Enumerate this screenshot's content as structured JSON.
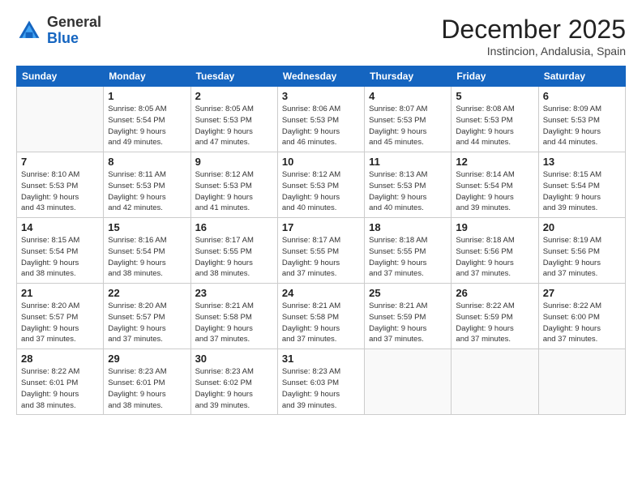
{
  "logo": {
    "general": "General",
    "blue": "Blue"
  },
  "header": {
    "month": "December 2025",
    "location": "Instincion, Andalusia, Spain"
  },
  "weekdays": [
    "Sunday",
    "Monday",
    "Tuesday",
    "Wednesday",
    "Thursday",
    "Friday",
    "Saturday"
  ],
  "weeks": [
    [
      {
        "day": "",
        "info": ""
      },
      {
        "day": "1",
        "info": "Sunrise: 8:05 AM\nSunset: 5:54 PM\nDaylight: 9 hours\nand 49 minutes."
      },
      {
        "day": "2",
        "info": "Sunrise: 8:05 AM\nSunset: 5:53 PM\nDaylight: 9 hours\nand 47 minutes."
      },
      {
        "day": "3",
        "info": "Sunrise: 8:06 AM\nSunset: 5:53 PM\nDaylight: 9 hours\nand 46 minutes."
      },
      {
        "day": "4",
        "info": "Sunrise: 8:07 AM\nSunset: 5:53 PM\nDaylight: 9 hours\nand 45 minutes."
      },
      {
        "day": "5",
        "info": "Sunrise: 8:08 AM\nSunset: 5:53 PM\nDaylight: 9 hours\nand 44 minutes."
      },
      {
        "day": "6",
        "info": "Sunrise: 8:09 AM\nSunset: 5:53 PM\nDaylight: 9 hours\nand 44 minutes."
      }
    ],
    [
      {
        "day": "7",
        "info": "Sunrise: 8:10 AM\nSunset: 5:53 PM\nDaylight: 9 hours\nand 43 minutes."
      },
      {
        "day": "8",
        "info": "Sunrise: 8:11 AM\nSunset: 5:53 PM\nDaylight: 9 hours\nand 42 minutes."
      },
      {
        "day": "9",
        "info": "Sunrise: 8:12 AM\nSunset: 5:53 PM\nDaylight: 9 hours\nand 41 minutes."
      },
      {
        "day": "10",
        "info": "Sunrise: 8:12 AM\nSunset: 5:53 PM\nDaylight: 9 hours\nand 40 minutes."
      },
      {
        "day": "11",
        "info": "Sunrise: 8:13 AM\nSunset: 5:53 PM\nDaylight: 9 hours\nand 40 minutes."
      },
      {
        "day": "12",
        "info": "Sunrise: 8:14 AM\nSunset: 5:54 PM\nDaylight: 9 hours\nand 39 minutes."
      },
      {
        "day": "13",
        "info": "Sunrise: 8:15 AM\nSunset: 5:54 PM\nDaylight: 9 hours\nand 39 minutes."
      }
    ],
    [
      {
        "day": "14",
        "info": "Sunrise: 8:15 AM\nSunset: 5:54 PM\nDaylight: 9 hours\nand 38 minutes."
      },
      {
        "day": "15",
        "info": "Sunrise: 8:16 AM\nSunset: 5:54 PM\nDaylight: 9 hours\nand 38 minutes."
      },
      {
        "day": "16",
        "info": "Sunrise: 8:17 AM\nSunset: 5:55 PM\nDaylight: 9 hours\nand 38 minutes."
      },
      {
        "day": "17",
        "info": "Sunrise: 8:17 AM\nSunset: 5:55 PM\nDaylight: 9 hours\nand 37 minutes."
      },
      {
        "day": "18",
        "info": "Sunrise: 8:18 AM\nSunset: 5:55 PM\nDaylight: 9 hours\nand 37 minutes."
      },
      {
        "day": "19",
        "info": "Sunrise: 8:18 AM\nSunset: 5:56 PM\nDaylight: 9 hours\nand 37 minutes."
      },
      {
        "day": "20",
        "info": "Sunrise: 8:19 AM\nSunset: 5:56 PM\nDaylight: 9 hours\nand 37 minutes."
      }
    ],
    [
      {
        "day": "21",
        "info": "Sunrise: 8:20 AM\nSunset: 5:57 PM\nDaylight: 9 hours\nand 37 minutes."
      },
      {
        "day": "22",
        "info": "Sunrise: 8:20 AM\nSunset: 5:57 PM\nDaylight: 9 hours\nand 37 minutes."
      },
      {
        "day": "23",
        "info": "Sunrise: 8:21 AM\nSunset: 5:58 PM\nDaylight: 9 hours\nand 37 minutes."
      },
      {
        "day": "24",
        "info": "Sunrise: 8:21 AM\nSunset: 5:58 PM\nDaylight: 9 hours\nand 37 minutes."
      },
      {
        "day": "25",
        "info": "Sunrise: 8:21 AM\nSunset: 5:59 PM\nDaylight: 9 hours\nand 37 minutes."
      },
      {
        "day": "26",
        "info": "Sunrise: 8:22 AM\nSunset: 5:59 PM\nDaylight: 9 hours\nand 37 minutes."
      },
      {
        "day": "27",
        "info": "Sunrise: 8:22 AM\nSunset: 6:00 PM\nDaylight: 9 hours\nand 37 minutes."
      }
    ],
    [
      {
        "day": "28",
        "info": "Sunrise: 8:22 AM\nSunset: 6:01 PM\nDaylight: 9 hours\nand 38 minutes."
      },
      {
        "day": "29",
        "info": "Sunrise: 8:23 AM\nSunset: 6:01 PM\nDaylight: 9 hours\nand 38 minutes."
      },
      {
        "day": "30",
        "info": "Sunrise: 8:23 AM\nSunset: 6:02 PM\nDaylight: 9 hours\nand 39 minutes."
      },
      {
        "day": "31",
        "info": "Sunrise: 8:23 AM\nSunset: 6:03 PM\nDaylight: 9 hours\nand 39 minutes."
      },
      {
        "day": "",
        "info": ""
      },
      {
        "day": "",
        "info": ""
      },
      {
        "day": "",
        "info": ""
      }
    ]
  ]
}
